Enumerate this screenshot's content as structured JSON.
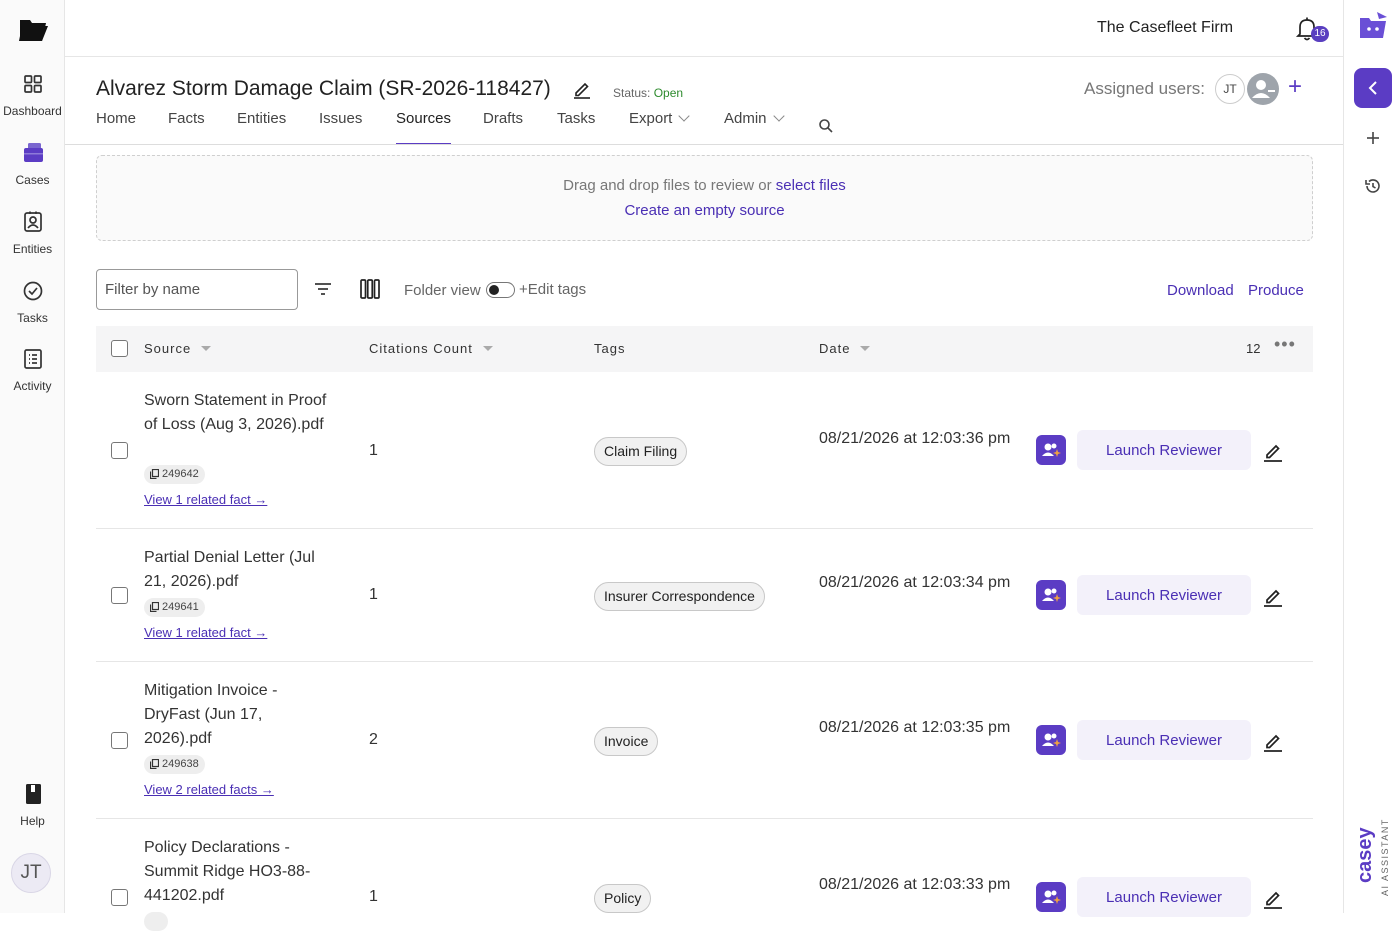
{
  "header": {
    "firm_name": "The Casefleet Firm",
    "notification_count": "16"
  },
  "nav": {
    "items": [
      {
        "label": "Dashboard",
        "icon": "grid-icon"
      },
      {
        "label": "Cases",
        "icon": "briefcase-icon"
      },
      {
        "label": "Entities",
        "icon": "contact-card-icon"
      },
      {
        "label": "Tasks",
        "icon": "check-circle-icon"
      },
      {
        "label": "Activity",
        "icon": "list-icon"
      }
    ],
    "help_label": "Help",
    "user_initials": "JT"
  },
  "case": {
    "title": "Alvarez Storm Damage Claim (SR-2026-118427)",
    "status_label": "Status:",
    "status_value": "Open",
    "status_color": "#2e8b2e",
    "assigned_label": "Assigned users:",
    "assigned_initials": "JT"
  },
  "tabs": [
    {
      "label": "Home"
    },
    {
      "label": "Facts"
    },
    {
      "label": "Entities"
    },
    {
      "label": "Issues"
    },
    {
      "label": "Sources",
      "active": true
    },
    {
      "label": "Drafts"
    },
    {
      "label": "Tasks"
    },
    {
      "label": "Export",
      "dropdown": true
    },
    {
      "label": "Admin",
      "dropdown": true
    }
  ],
  "dropzone": {
    "text": "Drag and drop files to review or",
    "select_link": "select files",
    "create_link": "Create an empty source"
  },
  "toolbar": {
    "filter_placeholder": "Filter by name",
    "folder_view_label": "Folder view",
    "edit_tags_label": "+Edit tags",
    "download_label": "Download",
    "produce_label": "Produce"
  },
  "table": {
    "headers": {
      "source": "Source",
      "citations": "Citations Count",
      "tags": "Tags",
      "date": "Date"
    },
    "total_count": "12",
    "launch_label": "Launch Reviewer",
    "rows": [
      {
        "name": "Sworn Statement in Proof of Loss (Aug 3, 2026).pdf",
        "id": "249642",
        "related": "View 1 related fact →",
        "citations": "1",
        "tag": "Claim Filing",
        "date": "08/21/2026 at 12:03:36 pm"
      },
      {
        "name": "Partial Denial Letter (Jul 21, 2026).pdf",
        "id": "249641",
        "related": "View 1 related fact →",
        "citations": "1",
        "tag": "Insurer Correspondence",
        "date": "08/21/2026 at 12:03:34 pm"
      },
      {
        "name": "Mitigation Invoice - DryFast (Jun 17, 2026).pdf",
        "id": "249638",
        "related": "View 2 related facts →",
        "citations": "2",
        "tag": "Invoice",
        "date": "08/21/2026 at 12:03:35 pm"
      },
      {
        "name": "Policy Declarations - Summit Ridge HO3-88-441202.pdf",
        "id": "",
        "related": "",
        "citations": "1",
        "tag": "Policy",
        "date": "08/21/2026 at 12:03:33 pm"
      }
    ]
  },
  "assistant": {
    "brand": "casey",
    "subtitle": "AI ASSISTANT",
    "accent": "#5b3cc4"
  }
}
